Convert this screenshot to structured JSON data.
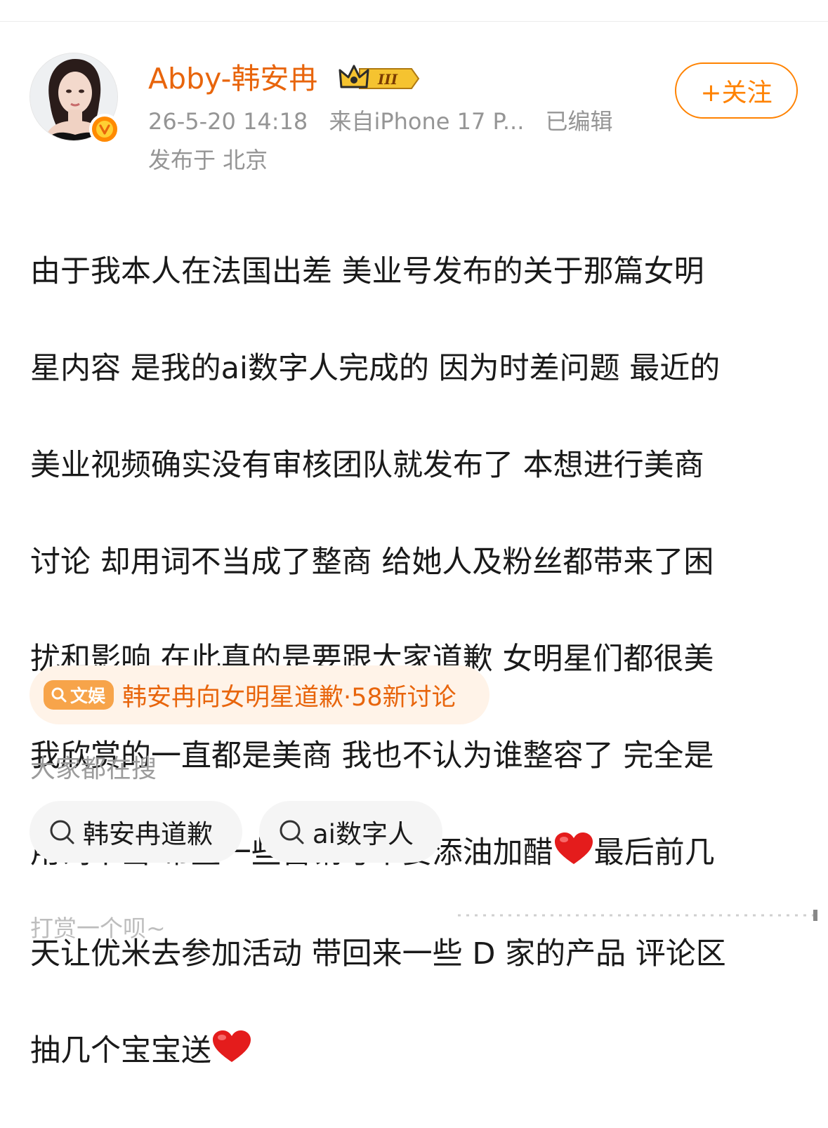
{
  "post": {
    "author": {
      "name": "Abby-韩安冉",
      "avatar": "avatar-photo",
      "verified_icon": "verified-v-icon",
      "vip_badge_text": "III",
      "vip_badge_icon": "crown-icon",
      "accent_color": "#e8650c"
    },
    "meta": {
      "timestamp": "26-5-20 14:18",
      "source": "来自iPhone 17 P...",
      "edited": "已编辑",
      "location": "发布于 北京"
    },
    "follow_label": "+关注",
    "body_lines": [
      "由于我本人在法国出差 美业号发布的关于那篇女明",
      "星内容 是我的ai数字人完成的 因为时差问题 最近的",
      "美业视频确实没有审核团队就发布了 本想进行美商",
      "讨论 却用词不当成了整商 给她人及粉丝都带来了困",
      "扰和影响 在此真的是要跟大家道歉 女明星们都很美",
      "我欣赏的一直都是美商 我也不认为谁整容了 完全是",
      "用词不当 希望一些营销号不要添油加醋",
      "最后前几",
      "天让优米去参加活动 带回来一些 D 家的产品 评论区",
      "抽几个宝宝送"
    ],
    "emoji_icon": "red-heart-emoji"
  },
  "topic": {
    "tag_label": "文娱",
    "tag_icon": "search-icon",
    "text": "韩安冉向女明星道歉·58新讨论"
  },
  "search": {
    "heading": "大家都在搜",
    "chips": [
      "韩安冉道歉",
      "ai数字人"
    ]
  },
  "footer": {
    "reward_text": "打赏一个呗~"
  }
}
